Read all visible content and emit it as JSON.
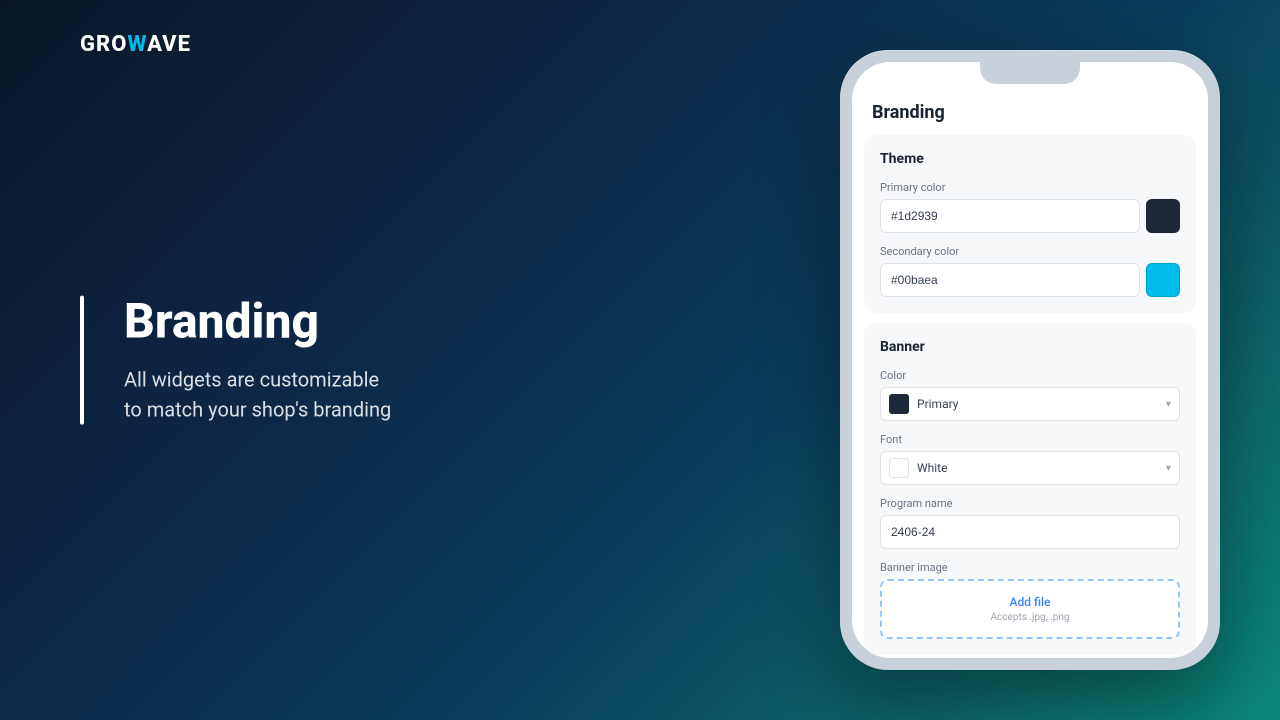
{
  "logo": {
    "prefix": "GRO",
    "wave": "W",
    "suffix": "AVE"
  },
  "left": {
    "title": "Branding",
    "subtitle": "All widgets are customizable\nto match your shop's branding"
  },
  "phone": {
    "page_title": "Branding",
    "theme": {
      "section_title": "Theme",
      "primary_color": {
        "label": "Primary color",
        "value": "#1d2939",
        "swatch": "#1d2939"
      },
      "secondary_color": {
        "label": "Secondary color",
        "value": "#00baea",
        "swatch": "#00baea"
      }
    },
    "banner": {
      "section_title": "Banner",
      "color": {
        "label": "Color",
        "value": "Primary",
        "swatch": "#1d2939"
      },
      "font": {
        "label": "Font",
        "value": "White"
      },
      "program_name": {
        "label": "Program name",
        "value": "2406-24"
      },
      "banner_image": {
        "label": "Banner image",
        "upload_text": "Add file",
        "upload_hint": "Accepts .jpg, .png"
      }
    }
  }
}
